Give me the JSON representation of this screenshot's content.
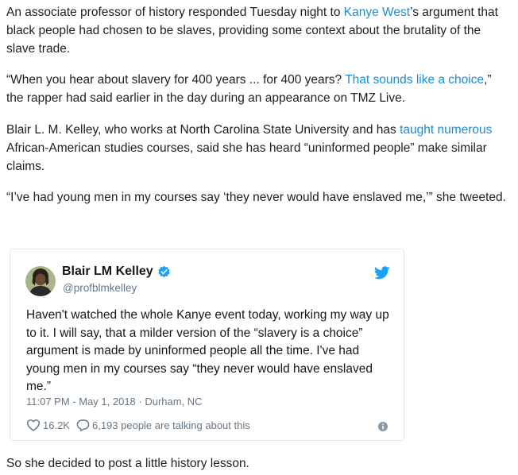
{
  "article": {
    "p1": {
      "before": "An associate professor of history responded Tuesday night to ",
      "link": "Kanye West",
      "after": "’s argument that black people had chosen to be slaves, providing some context about the brutality of the slave trade."
    },
    "p2": {
      "before": "“When you hear about slavery for 400 years ... for 400 years? ",
      "link": "That sounds like a choice",
      "after": ",” the rapper had said earlier in the day during an appearance on TMZ Live."
    },
    "p3": {
      "before": "Blair L. M. Kelley, who works at North Carolina State University and has ",
      "link": "taught numerous",
      "after": " African-American studies courses, said she has heard “uninformed people” make similar claims."
    },
    "p4": "“I’ve had young men in my courses say ‘they never would have enslaved me,’” she tweeted.",
    "p5": "So she decided to post a little history lesson."
  },
  "tweet": {
    "author_name": "Blair LM Kelley",
    "handle": "@profblmkelley",
    "text": "Haven't watched the whole Kanye event today, working my way up to it. I will say, that a milder version of the “slavery is a choice” argument is made by uninformed people all the time. I've had young men in my courses say “they never would have enslaved me.”",
    "meta": "11:07 PM - May 1, 2018 · Durham, NC",
    "likes": "16.2K",
    "replies_text": "6,193 people are talking about this"
  },
  "colors": {
    "link": "#1a8cd8",
    "twitter_blue": "#1da1f2",
    "muted": "#657786"
  },
  "icons": [
    "verified-badge-icon",
    "twitter-bird-icon",
    "heart-icon",
    "reply-bubble-icon",
    "info-icon"
  ]
}
